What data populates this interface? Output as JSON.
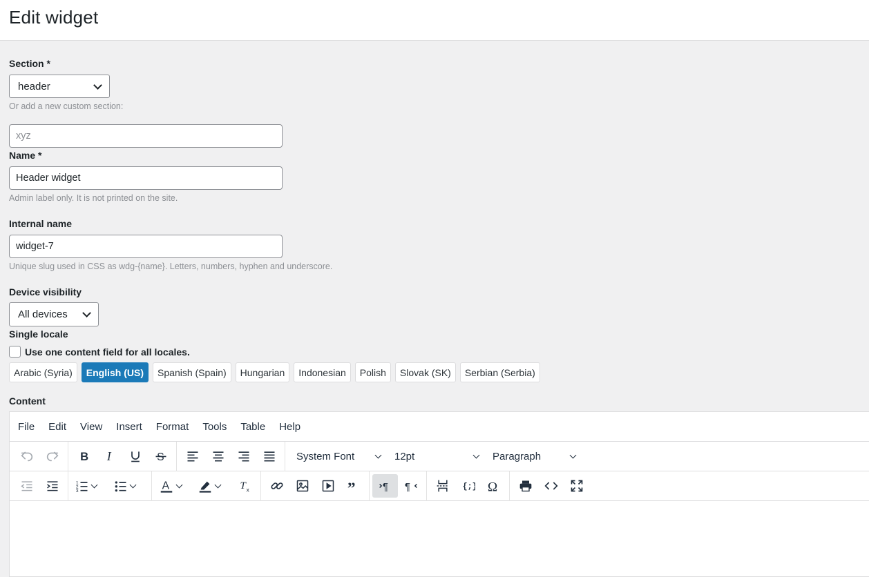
{
  "page": {
    "title": "Edit widget"
  },
  "section": {
    "label": "Section *",
    "value": "header",
    "custom_hint": "Or add a new custom section:",
    "custom_placeholder": "xyz"
  },
  "name": {
    "label": "Name *",
    "value": "Header widget",
    "help": "Admin label only. It is not printed on the site."
  },
  "internal_name": {
    "label": "Internal name",
    "value": "widget-7",
    "help": "Unique slug used in CSS as wdg-{name}. Letters, numbers, hyphen and underscore."
  },
  "device_visibility": {
    "label": "Device visibility",
    "value": "All devices"
  },
  "single_locale": {
    "label": "Single locale",
    "checkbox_label": "Use one content field for all locales.",
    "checked": false
  },
  "locales": [
    {
      "label": "Arabic (Syria)",
      "active": false
    },
    {
      "label": "English (US)",
      "active": true
    },
    {
      "label": "Spanish (Spain)",
      "active": false
    },
    {
      "label": "Hungarian",
      "active": false
    },
    {
      "label": "Indonesian",
      "active": false
    },
    {
      "label": "Polish",
      "active": false
    },
    {
      "label": "Slovak (SK)",
      "active": false
    },
    {
      "label": "Serbian (Serbia)",
      "active": false
    }
  ],
  "content": {
    "label": "Content",
    "menus": [
      "File",
      "Edit",
      "View",
      "Insert",
      "Format",
      "Tools",
      "Table",
      "Help"
    ],
    "font_family": "System Font",
    "font_size": "12pt",
    "block_format": "Paragraph",
    "toolbar_icons": [
      "undo-icon",
      "redo-icon",
      "bold-icon",
      "italic-icon",
      "underline-icon",
      "strikethrough-icon",
      "align-left-icon",
      "align-center-icon",
      "align-right-icon",
      "align-justify-icon",
      "outdent-icon",
      "indent-icon",
      "numbered-list-icon",
      "bullet-list-icon",
      "text-color-icon",
      "highlight-color-icon",
      "clear-formatting-icon",
      "link-icon",
      "image-icon",
      "media-icon",
      "blockquote-icon",
      "ltr-icon",
      "rtl-icon",
      "page-break-icon",
      "code-sample-icon",
      "special-char-icon",
      "print-icon",
      "source-code-icon",
      "fullscreen-icon"
    ]
  },
  "colors": {
    "accent": "#1b7ab8",
    "page_bg": "#f0f0f1",
    "help_text": "#8c8f94"
  }
}
